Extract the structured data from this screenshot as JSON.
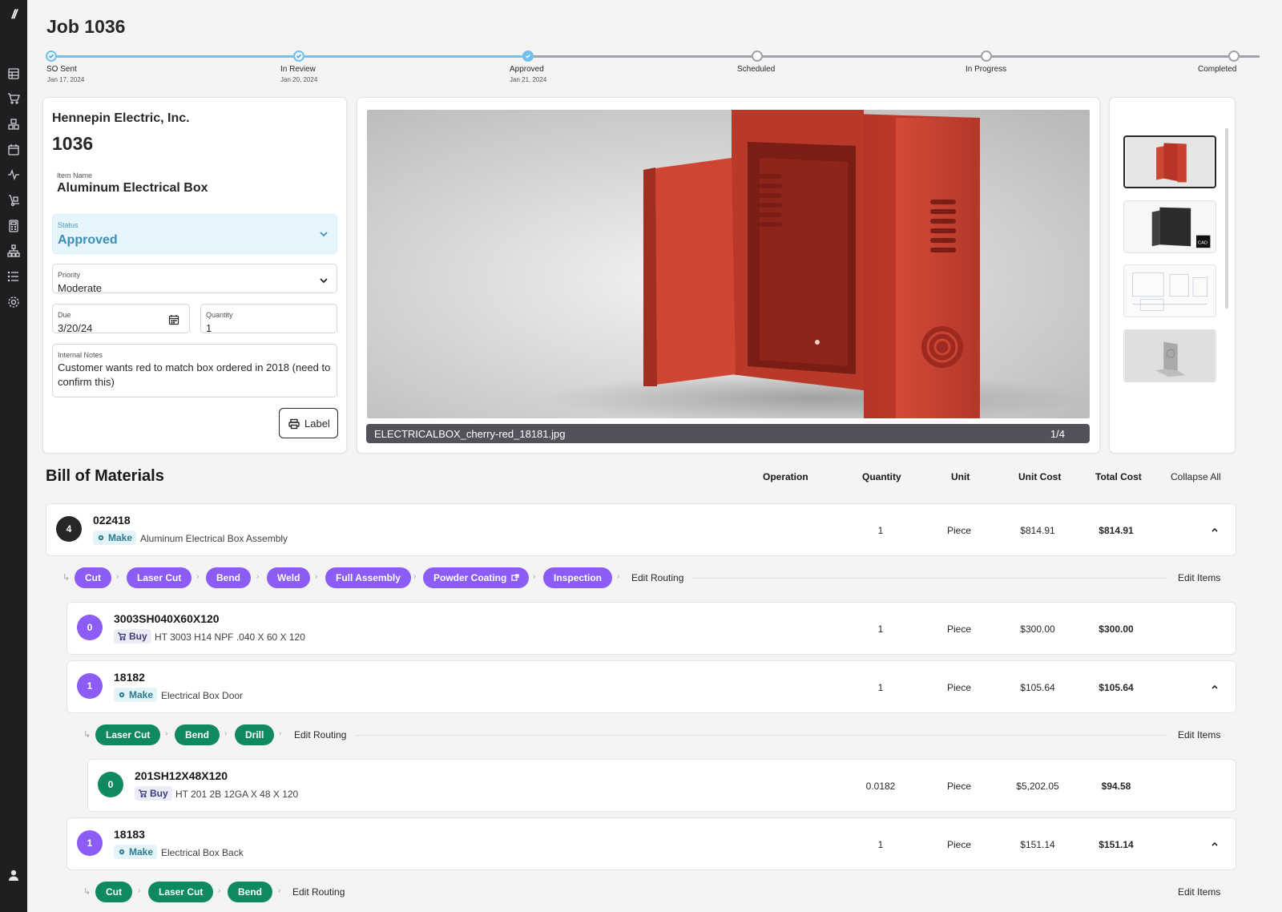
{
  "app": {
    "logo": "//"
  },
  "page": {
    "title": "Job 1036"
  },
  "progress": {
    "steps": [
      {
        "label": "SO Sent",
        "date": "Jan 17, 2024",
        "state": "done"
      },
      {
        "label": "In Review",
        "date": "Jan 20, 2024",
        "state": "done"
      },
      {
        "label": "Approved",
        "date": "Jan 21, 2024",
        "state": "current"
      },
      {
        "label": "Scheduled",
        "date": "",
        "state": "pending"
      },
      {
        "label": "In Progress",
        "date": "",
        "state": "pending"
      },
      {
        "label": "Completed",
        "date": "",
        "state": "pending"
      }
    ]
  },
  "job": {
    "company": "Hennepin Electric, Inc.",
    "number": "1036",
    "item_name_label": "Item Name",
    "item_name": "Aluminum Electrical Box",
    "status_label": "Status",
    "status": "Approved",
    "priority_label": "Priority",
    "priority": "Moderate",
    "due_label": "Due",
    "due": "3/20/24",
    "quantity_label": "Quantity",
    "quantity": "1",
    "notes_label": "Internal Notes",
    "notes": "Customer wants red to match box ordered in 2018 (need to confirm this)",
    "label_button": "Label"
  },
  "viewer": {
    "filename": "ELECTRICALBOX_cherry-red_18181.jpg",
    "counter": "1/4",
    "thumbnails": [
      "red-box-render",
      "black-box-cad",
      "technical-drawing",
      "bracket-render"
    ],
    "selected": 0
  },
  "bom": {
    "title": "Bill of Materials",
    "columns": {
      "operation": "Operation",
      "quantity": "Quantity",
      "unit": "Unit",
      "unit_cost": "Unit Cost",
      "total_cost": "Total Cost"
    },
    "collapse_all": "Collapse All",
    "edit_routing": "Edit Routing",
    "edit_items": "Edit Items",
    "items": [
      {
        "badge": "4",
        "part": "022418",
        "kind": "Make",
        "desc": "Aluminum Electrical Box Assembly",
        "qty": "1",
        "unit": "Piece",
        "unit_cost": "$814.91",
        "total": "$814.91"
      },
      {
        "badge": "0",
        "part": "3003SH040X60X120",
        "kind": "Buy",
        "desc": "HT 3003 H14 NPF .040 X 60 X 120",
        "qty": "1",
        "unit": "Piece",
        "unit_cost": "$300.00",
        "total": "$300.00"
      },
      {
        "badge": "1",
        "part": "18182",
        "kind": "Make",
        "desc": "Electrical Box Door",
        "qty": "1",
        "unit": "Piece",
        "unit_cost": "$105.64",
        "total": "$105.64"
      },
      {
        "badge": "0",
        "part": "201SH12X48X120",
        "kind": "Buy",
        "desc": "HT 201 2B 12GA X 48 X 120",
        "qty": "0.0182",
        "unit": "Piece",
        "unit_cost": "$5,202.05",
        "total": "$94.58"
      },
      {
        "badge": "1",
        "part": "18183",
        "kind": "Make",
        "desc": "Electrical Box Back",
        "qty": "1",
        "unit": "Piece",
        "unit_cost": "$151.14",
        "total": "$151.14"
      }
    ],
    "routing1": [
      "Cut",
      "Laser Cut",
      "Bend",
      "Weld",
      "Full Assembly",
      "Powder Coating",
      "Inspection"
    ],
    "routing2": [
      "Laser Cut",
      "Bend",
      "Drill"
    ],
    "routing3": [
      "Cut",
      "Laser Cut",
      "Bend"
    ]
  },
  "colors": {
    "purple": "#8b5cf6",
    "green": "#0f8a5f",
    "accent": "#74c0ec",
    "box_red": "#c8392b"
  }
}
